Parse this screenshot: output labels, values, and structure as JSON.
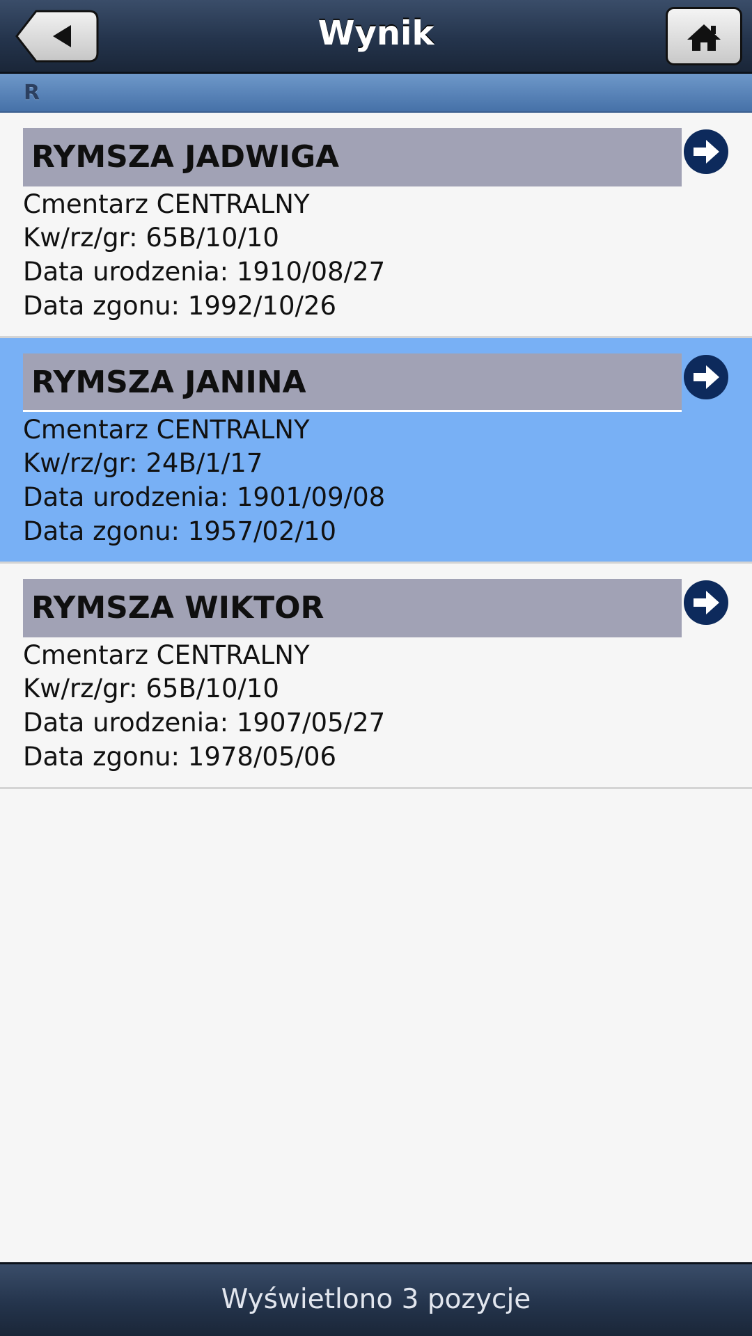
{
  "header": {
    "title": "Wynik",
    "back_icon": "back-arrow-icon",
    "home_icon": "home-icon"
  },
  "divider": {
    "letter": "R"
  },
  "results": [
    {
      "name": "RYMSZA JADWIGA",
      "cemetery": "Cmentarz CENTRALNY",
      "location": "Kw/rz/gr: 65B/10/10",
      "birth": "Data urodzenia: 1910/08/27",
      "death": "Data zgonu: 1992/10/26",
      "selected": false
    },
    {
      "name": "RYMSZA JANINA",
      "cemetery": "Cmentarz CENTRALNY",
      "location": "Kw/rz/gr: 24B/1/17",
      "birth": "Data urodzenia: 1901/09/08",
      "death": "Data zgonu: 1957/02/10",
      "selected": true
    },
    {
      "name": "RYMSZA WIKTOR",
      "cemetery": "Cmentarz CENTRALNY",
      "location": "Kw/rz/gr: 65B/10/10",
      "birth": "Data urodzenia: 1907/05/27",
      "death": "Data zgonu: 1978/05/06",
      "selected": false
    }
  ],
  "footer": {
    "status": "Wyświetlono 3 pozycje"
  },
  "colors": {
    "header_bg": "#24344c",
    "divider_bg": "#5a83b8",
    "selected_bg": "#78b0f5",
    "name_band": "#a1a2b5",
    "arrow_circle": "#0d2a5c"
  }
}
